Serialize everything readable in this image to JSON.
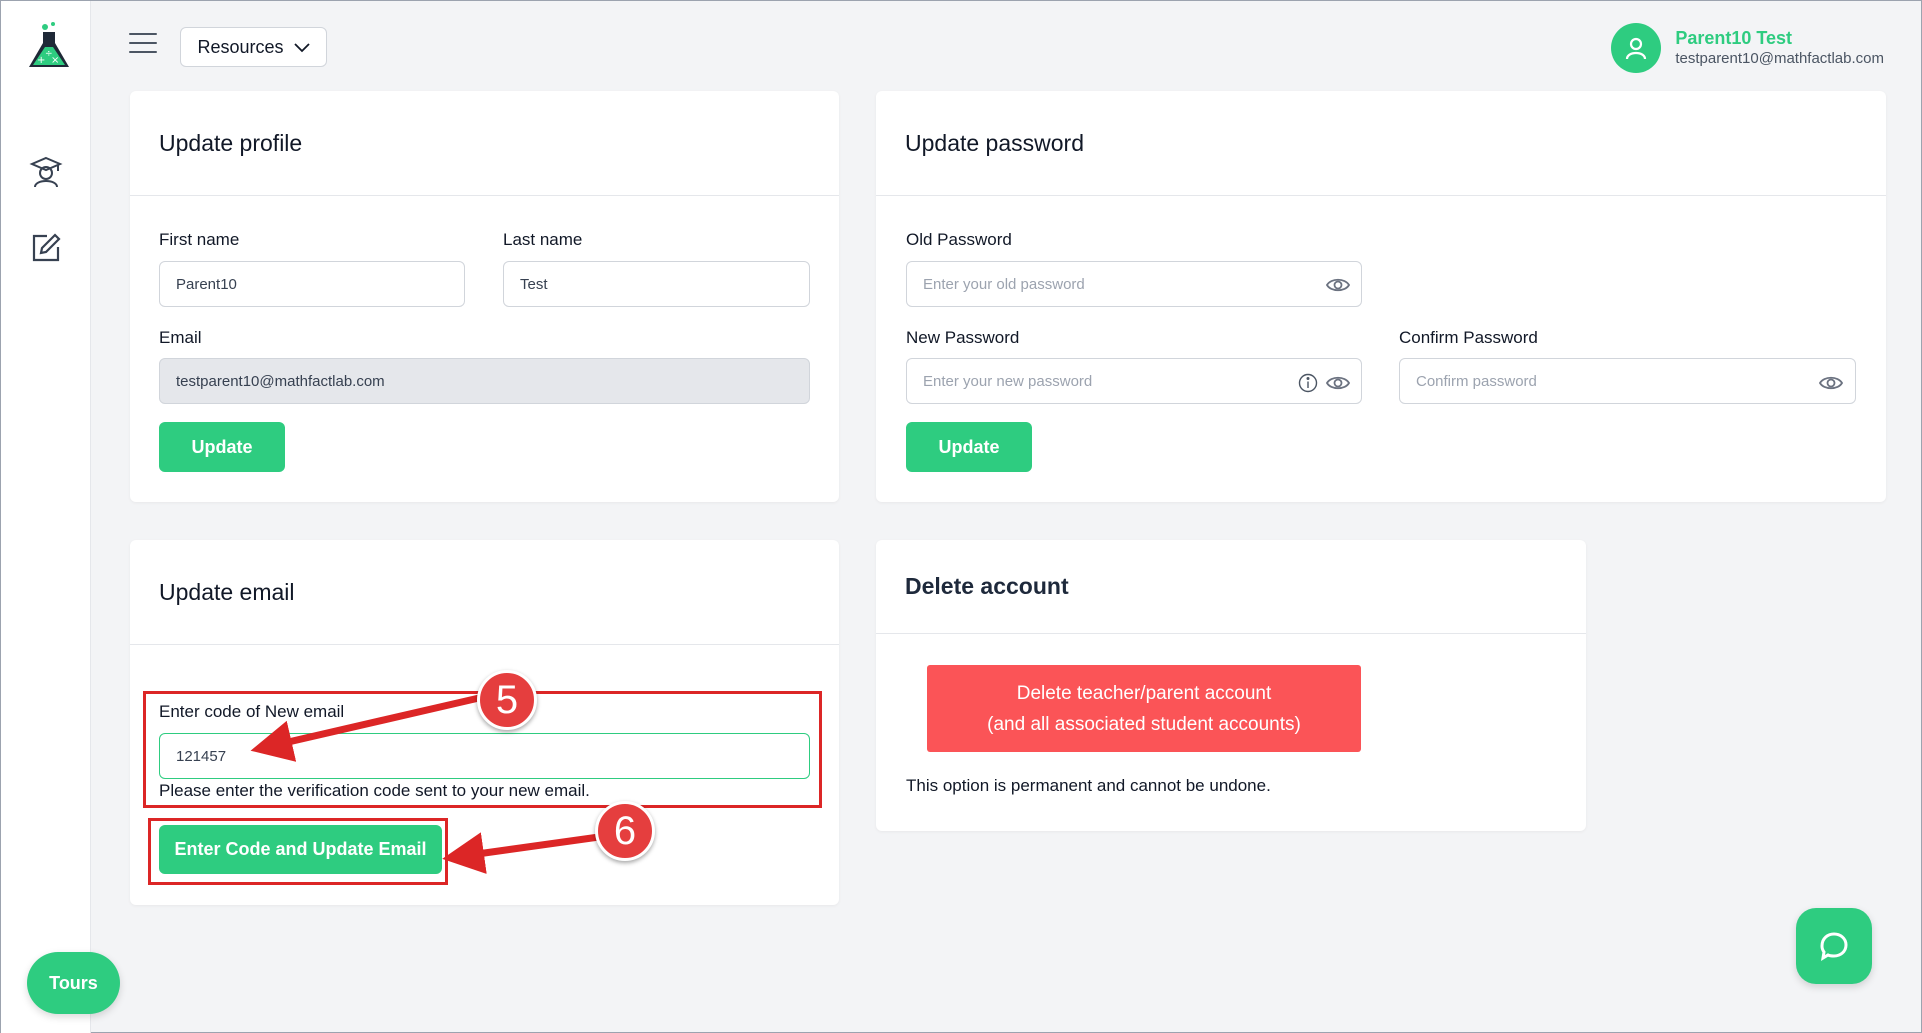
{
  "header": {
    "resources_label": "Resources",
    "user_name": "Parent10 Test",
    "user_email": "testparent10@mathfactlab.com"
  },
  "profile": {
    "title": "Update profile",
    "first_name_label": "First name",
    "first_name_value": "Parent10",
    "last_name_label": "Last name",
    "last_name_value": "Test",
    "email_label": "Email",
    "email_value": "testparent10@mathfactlab.com",
    "update_label": "Update"
  },
  "password": {
    "title": "Update password",
    "old_label": "Old Password",
    "old_placeholder": "Enter your old password",
    "new_label": "New Password",
    "new_placeholder": "Enter your new password",
    "confirm_label": "Confirm Password",
    "confirm_placeholder": "Confirm password",
    "update_label": "Update"
  },
  "email_update": {
    "title": "Update email",
    "code_label": "Enter code of New email",
    "code_value": "121457",
    "hint": "Please enter the verification code sent to your new email.",
    "submit_label": "Enter Code and Update Email"
  },
  "delete_account": {
    "title": "Delete account",
    "button_line1": "Delete teacher/parent account",
    "button_line2": "(and all associated student accounts)",
    "note": "This option is permanent and cannot be undone."
  },
  "annotations": {
    "step_a": "5",
    "step_b": "6"
  },
  "tours_label": "Tours",
  "colors": {
    "accent": "#2ecc80",
    "danger": "#fb5457",
    "annotation_red": "#dc2626"
  },
  "icons": [
    "logo-flask-icon",
    "hamburger-icon",
    "chevron-down-icon",
    "user-icon",
    "graduate-icon",
    "edit-icon",
    "eye-icon",
    "info-icon",
    "chat-icon"
  ]
}
